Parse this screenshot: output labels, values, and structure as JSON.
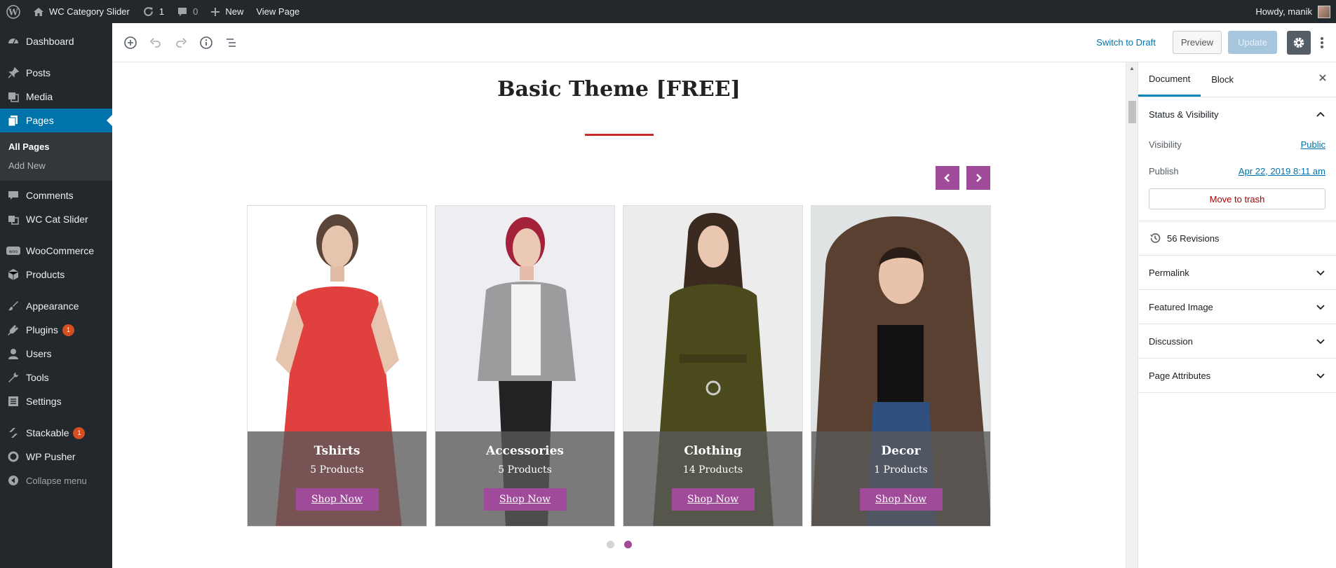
{
  "adminbar": {
    "site_name": "WC Category Slider",
    "updates_count": "1",
    "comments_count": "0",
    "new_label": "New",
    "view_page": "View Page",
    "howdy": "Howdy, manik"
  },
  "sidebar": {
    "items": [
      {
        "label": "Dashboard",
        "icon": "dashboard-icon"
      },
      {
        "label": "Posts",
        "icon": "pin-icon"
      },
      {
        "label": "Media",
        "icon": "media-icon"
      },
      {
        "label": "Pages",
        "icon": "pages-icon"
      },
      {
        "label": "Comments",
        "icon": "comment-icon"
      },
      {
        "label": "WC Cat Slider",
        "icon": "slider-icon"
      },
      {
        "label": "WooCommerce",
        "icon": "woo-icon"
      },
      {
        "label": "Products",
        "icon": "box-icon"
      },
      {
        "label": "Appearance",
        "icon": "brush-icon"
      },
      {
        "label": "Plugins",
        "icon": "plug-icon",
        "badge": "1"
      },
      {
        "label": "Users",
        "icon": "user-icon"
      },
      {
        "label": "Tools",
        "icon": "wrench-icon"
      },
      {
        "label": "Settings",
        "icon": "settings-icon"
      },
      {
        "label": "Stackable",
        "icon": "stackable-icon",
        "badge": "1"
      },
      {
        "label": "WP Pusher",
        "icon": "circle-icon"
      }
    ],
    "submenu": [
      "All Pages",
      "Add New"
    ],
    "collapse": "Collapse menu"
  },
  "editor_header": {
    "switch_to_draft": "Switch to Draft",
    "preview": "Preview",
    "update": "Update"
  },
  "canvas": {
    "title": "Basic Theme [FREE]",
    "cards": [
      {
        "name": "Tshirts",
        "count": "5 Products",
        "button": "Shop Now"
      },
      {
        "name": "Accessories",
        "count": "5 Products",
        "button": "Shop Now"
      },
      {
        "name": "Clothing",
        "count": "14 Products",
        "button": "Shop Now"
      },
      {
        "name": "Decor",
        "count": "1 Products",
        "button": "Shop Now"
      }
    ],
    "active_dot": 2
  },
  "panel": {
    "tabs": [
      "Document",
      "Block"
    ],
    "status_visibility": "Status & Visibility",
    "visibility_label": "Visibility",
    "visibility_value": "Public",
    "publish_label": "Publish",
    "publish_value": "Apr 22, 2019 8:11 am",
    "move_to_trash": "Move to trash",
    "revisions": "56 Revisions",
    "sections": [
      "Permalink",
      "Featured Image",
      "Discussion",
      "Page Attributes"
    ]
  },
  "colors": {
    "adminbar_bg": "#23282d",
    "menu_current": "#0073aa",
    "accent_purple": "#a04a9a",
    "title_underline": "#c62d2d"
  }
}
